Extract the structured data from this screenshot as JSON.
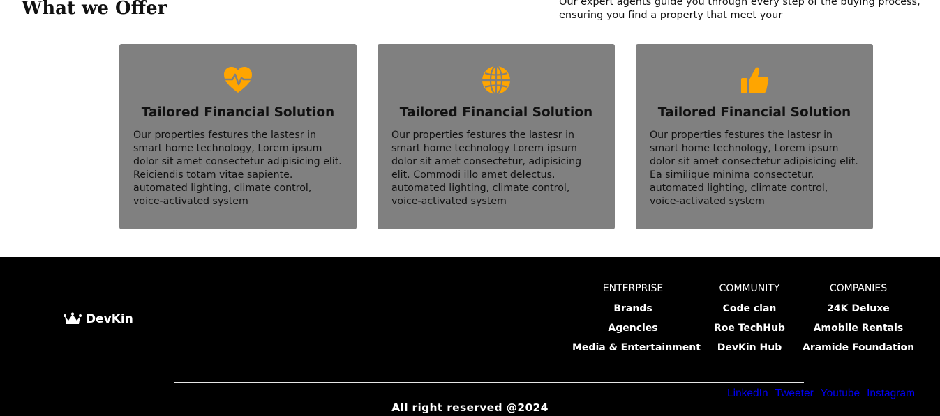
{
  "section": {
    "title": "What we Offer",
    "intro": "Our expert agents guide you through every step of the buying process, ensuring you find a property that meet your"
  },
  "cards": [
    {
      "icon": "heart-pulse-icon",
      "title": "Tailored Financial Solution",
      "text": "Our properties festures the lastesr in smart home technology, Lorem ipsum dolor sit amet consectetur adipisicing elit. Reiciendis totam vitae sapiente. automated lighting, climate control, voice-activated system"
    },
    {
      "icon": "globe-icon",
      "title": "Tailored Financial Solution",
      "text": "Our properties festures the lastesr in smart home technology Lorem ipsum dolor sit amet consectetur, adipisicing elit. Commodi illo amet delectus. automated lighting, climate control, voice-activated system"
    },
    {
      "icon": "thumbs-up-icon",
      "title": "Tailored Financial Solution",
      "text": "Our properties festures the lastesr in smart home technology, Lorem ipsum dolor sit amet consectetur adipisicing elit. Ea similique minima consectetur. automated lighting, climate control, voice-activated system"
    }
  ],
  "colors": {
    "accent": "#FFA500",
    "card_bg": "#808080",
    "footer_bg": "#000000",
    "social_link": "#0000EE"
  },
  "footer": {
    "brand": "DevKin",
    "brand_icon": "crown-icon",
    "columns": [
      {
        "heading": "ENTERPRISE",
        "links": [
          "Brands",
          "Agencies",
          "Media & Entertainment"
        ]
      },
      {
        "heading": "COMMUNITY",
        "links": [
          "Code clan",
          "Roe TechHub",
          "DevKin Hub"
        ]
      },
      {
        "heading": "COMPANIES",
        "links": [
          "24K Deluxe",
          "Amobile Rentals",
          "Aramide Foundation"
        ]
      }
    ],
    "social": [
      "LinkedIn",
      "Tweeter",
      "Youtube",
      "Instagram"
    ],
    "copyright": "All right reserved @2024"
  }
}
